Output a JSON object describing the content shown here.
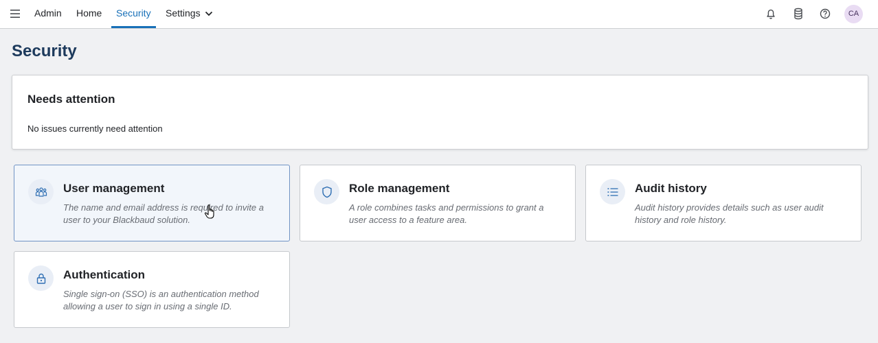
{
  "nav": {
    "menu_icon": "hamburger-menu-icon",
    "items": [
      {
        "label": "Admin"
      },
      {
        "label": "Home"
      },
      {
        "label": "Security",
        "active": true
      },
      {
        "label": "Settings",
        "has_dropdown": true
      }
    ],
    "right_icons": [
      "bell-icon",
      "database-icon",
      "help-icon"
    ],
    "avatar_initials": "CA"
  },
  "page": {
    "title": "Security"
  },
  "attention": {
    "heading": "Needs attention",
    "message": "No issues currently need attention"
  },
  "cards": [
    {
      "title": "User management",
      "description": "The name and email address is required to invite a user to your Blackbaud solution.",
      "icon": "users-icon",
      "hovered": true
    },
    {
      "title": "Role management",
      "description": "A role combines tasks and permissions to grant a user access to a feature area.",
      "icon": "shield-icon"
    },
    {
      "title": "Audit history",
      "description": "Audit history provides details such as user audit history and role history.",
      "icon": "list-icon"
    },
    {
      "title": "Authentication",
      "description": "Single sign-on (SSO) is an authentication method allowing a user to sign in using a single ID.",
      "icon": "lock-icon"
    }
  ],
  "colors": {
    "accent": "#1870b8",
    "title": "#1d3a5c",
    "background": "#f0f1f3",
    "icon": "#2f6fb3",
    "avatar_bg": "#e9dcf3"
  }
}
